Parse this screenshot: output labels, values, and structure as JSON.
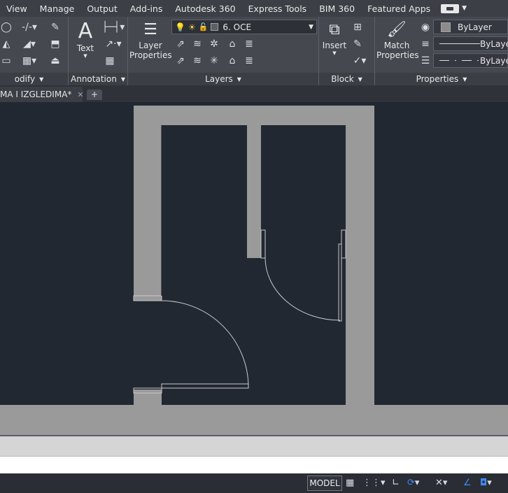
{
  "menu": {
    "items": [
      "View",
      "Manage",
      "Output",
      "Add-ins",
      "Autodesk 360",
      "Express Tools",
      "BIM 360",
      "Featured Apps"
    ]
  },
  "ribbon": {
    "modify": {
      "title": "odify"
    },
    "annotation": {
      "title": "Annotation",
      "text_label": "Text"
    },
    "layers": {
      "title": "Layers",
      "layer_properties_line1": "Layer",
      "layer_properties_line2": "Properties",
      "current_layer": "6. OCE"
    },
    "block": {
      "title": "Block",
      "insert_label": "Insert"
    },
    "properties": {
      "title": "Properties",
      "match_line1": "Match",
      "match_line2": "Properties",
      "color": "ByLayer",
      "lineweight": "ByLayer",
      "linetype": "ByLayer"
    }
  },
  "tabs": {
    "file_tab": "MA I IZGLEDIMA*"
  },
  "status": {
    "model": "MODEL"
  },
  "icons": {
    "circle": "circle-icon",
    "trim": "trim-icon",
    "brush": "brush-icon",
    "mirror": "mirror-icon",
    "fillet": "fillet-icon",
    "array": "array-icon",
    "dimension": "dimension-icon",
    "leader": "leader-icon",
    "table": "table-icon"
  },
  "colors": {
    "canvas": "#222832",
    "wall": "#9a9a9a",
    "ribbon": "#45484f"
  }
}
